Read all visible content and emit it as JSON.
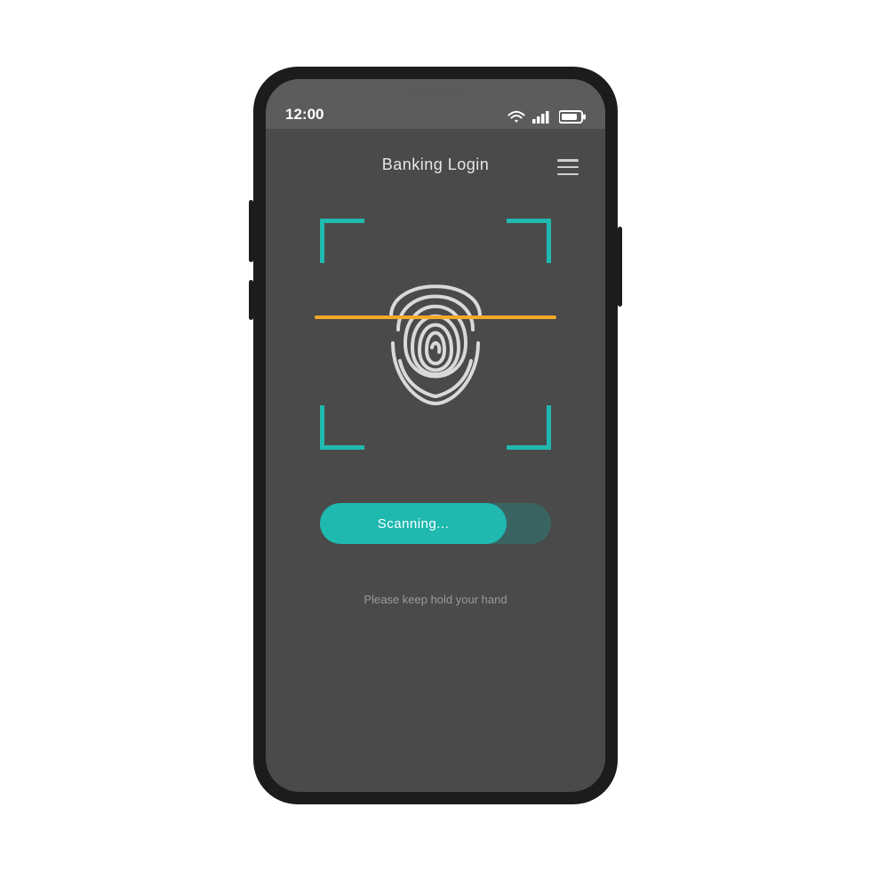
{
  "status": {
    "time": "12:00"
  },
  "header": {
    "title": "Banking Login"
  },
  "scan": {
    "button_label": "Scanning...",
    "hint": "Please keep hold your hand"
  },
  "colors": {
    "accent": "#1fb9b0",
    "scan_line": "#f2a926",
    "screen_bg": "#4a4a4a"
  },
  "icons": {
    "menu": "hamburger-icon",
    "wifi": "wifi-icon",
    "signal": "signal-icon",
    "battery": "battery-icon",
    "fingerprint": "fingerprint-icon"
  }
}
